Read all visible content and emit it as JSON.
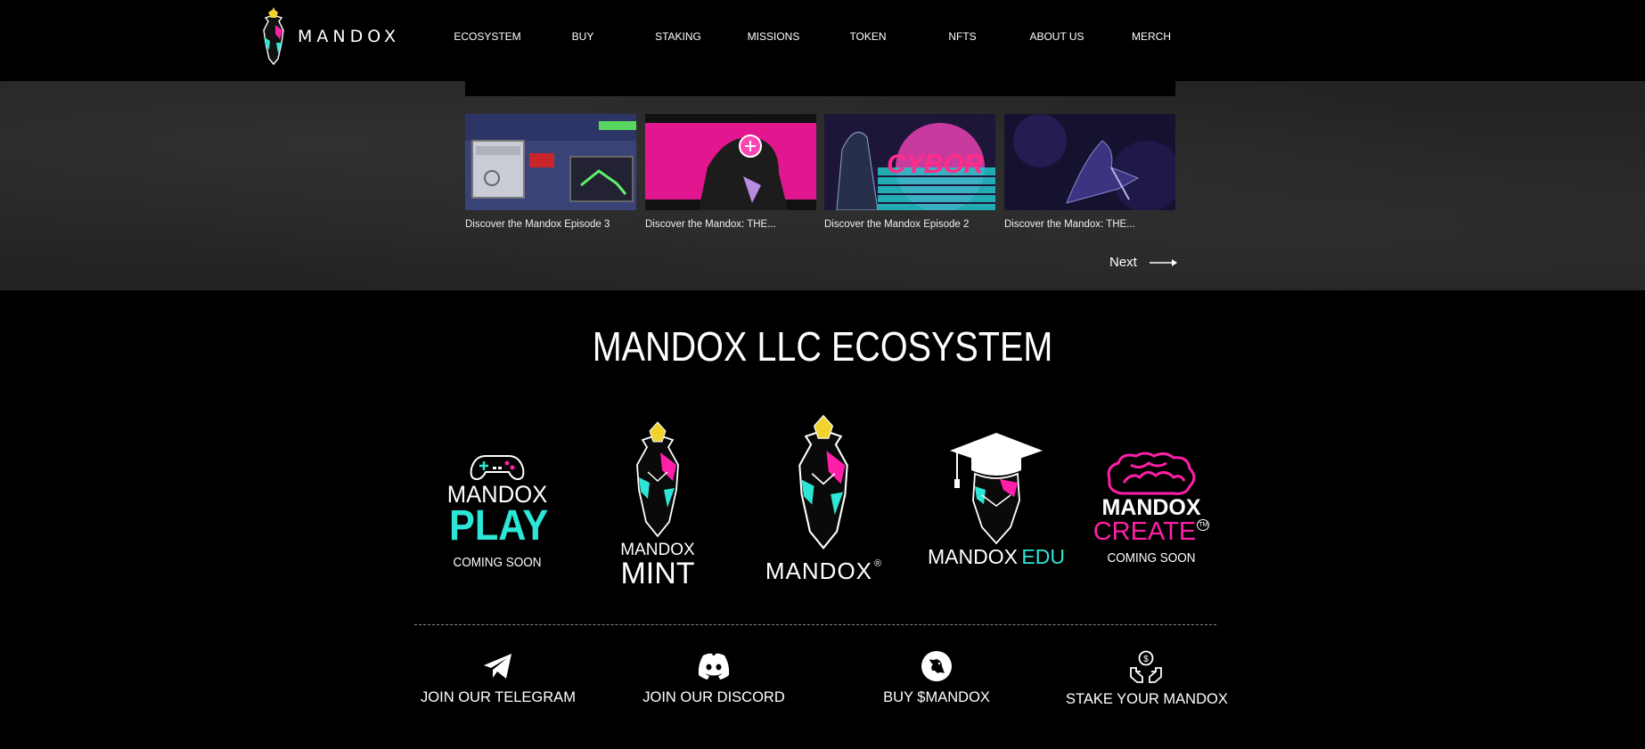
{
  "header": {
    "logo_text": "MANDOX",
    "nav": [
      {
        "label": "ECOSYSTEM"
      },
      {
        "label": "BUY"
      },
      {
        "label": "STAKING"
      },
      {
        "label": "MISSIONS"
      },
      {
        "label": "TOKEN"
      },
      {
        "label": "NFTS"
      },
      {
        "label": "ABOUT US"
      },
      {
        "label": "MERCH"
      }
    ]
  },
  "gallery": {
    "videos": [
      {
        "title": "Discover the Mandox Episode 3"
      },
      {
        "title": "Discover the Mandox: THE..."
      },
      {
        "title": "Discover the Mandox Episode 2"
      },
      {
        "title": "Discover the Mandox: THE..."
      }
    ],
    "thumb3_text": "CYBOR",
    "next_label": "Next"
  },
  "ecosystem": {
    "title": "MANDOX LLC ECOSYSTEM",
    "brands": [
      {
        "name": "play",
        "word1": "MANDOX",
        "word2": "PLAY",
        "status": "COMING SOON"
      },
      {
        "name": "mint",
        "word1": "MANDOX",
        "word2": "MINT"
      },
      {
        "name": "mandox",
        "word1": "MANDOX",
        "mark": "®"
      },
      {
        "name": "edu",
        "word1": "MANDOX",
        "word2": "EDU"
      },
      {
        "name": "create",
        "word1": "MANDOX",
        "word2": "CREATE",
        "mark": "TM",
        "status": "COMING SOON"
      }
    ]
  },
  "social": [
    {
      "label": "JOIN OUR TELEGRAM",
      "icon": "telegram-icon"
    },
    {
      "label": "JOIN OUR DISCORD",
      "icon": "discord-icon"
    },
    {
      "label": "BUY $MANDOX",
      "icon": "uniswap-icon"
    },
    {
      "label": "STAKE YOUR MANDOX",
      "icon": "stake-hands-icon"
    }
  ],
  "colors": {
    "background": "#000000",
    "cyan": "#2ee6d6",
    "magenta": "#ff1fa8",
    "gold": "#f2d22e"
  }
}
